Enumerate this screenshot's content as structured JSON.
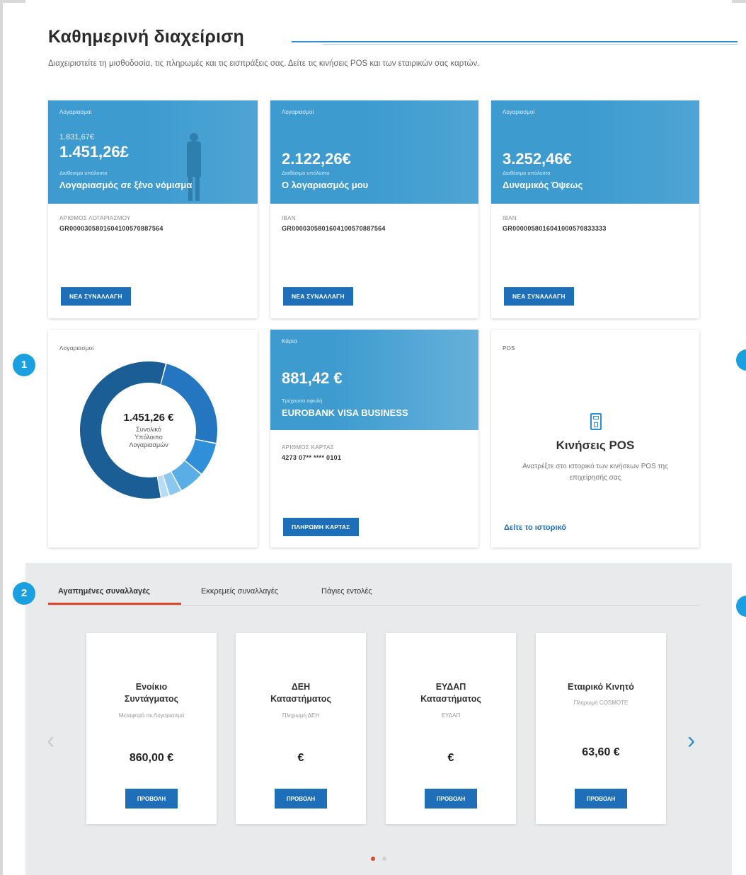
{
  "page": {
    "title": "Καθημερινή διαχείριση",
    "subtitle": "Διαχειριστείτε τη μισθοδοσία, τις πληρωμές και τις εισπράξεις σας. Δείτε τις κινήσεις POS και των εταιρικών σας καρτών."
  },
  "accounts": [
    {
      "tag": "Λογαριασμοί",
      "sub_amount": "1.831,67€",
      "amount": "1.451,26£",
      "amount_label": "Διαθέσιμο υπόλοιπο",
      "name": "Λογαριασμός σε ξένο νόμισμα",
      "field_label": "ΑΡΙΘΜΟΣ ΛΟΓΑΡΙΑΣΜΟΥ",
      "field_value": "GR0000305801604100570887564",
      "button": "ΝΕΑ ΣΥΝΑΛΛΑΓΗ"
    },
    {
      "tag": "Λογαριασμοί",
      "amount": "2.122,26€",
      "amount_label": "Διαθέσιμο υπόλοιπο",
      "name": "Ο λογαριασμός μου",
      "field_label": "IBAN",
      "field_value": "GR0000305801604100570887564",
      "button": "ΝΕΑ ΣΥΝΑΛΛΑΓΗ"
    },
    {
      "tag": "Λογαριασμοί",
      "amount": "3.252,46€",
      "amount_label": "Διαθέσιμο υπόλοιπο",
      "name": "Δυναμικός Όψεως",
      "field_label": "IBAN",
      "field_value": "GR0000058016041000570833333",
      "button": "ΝΕΑ ΣΥΝΑΛΛΑΓΗ"
    }
  ],
  "donut": {
    "tag": "Λογαριασμοί",
    "value": "1.451,26 €",
    "label_line1": "Συνολικό",
    "label_line2": "Υπόλοιπο",
    "label_line3": "Λογαριασμών",
    "segments": [
      {
        "share": 0.57,
        "color": "#1b5d95"
      },
      {
        "share": 0.24,
        "color": "#2476c0"
      },
      {
        "share": 0.08,
        "color": "#2f8fd8"
      },
      {
        "share": 0.06,
        "color": "#5aaee6"
      },
      {
        "share": 0.03,
        "color": "#8cc7ef"
      },
      {
        "share": 0.02,
        "color": "#b8dcf5"
      }
    ]
  },
  "card": {
    "tag": "Κάρτα",
    "amount": "881,42 €",
    "amount_label": "Τρέχουσα οφειλή",
    "name": "EUROBANK VISA BUSINESS",
    "field_label": "ΑΡΙΘΜΟΣ ΚΑΡΤΑΣ",
    "field_value": "4273 07** **** 0101",
    "button": "ΠΛΗΡΩΜΗ ΚΑΡΤΑΣ"
  },
  "pos": {
    "tag": "POS",
    "icon": "pos-terminal-icon",
    "title": "Κινήσεις POS",
    "description": "Ανατρέξτε στο ιστορικό των κινήσεων POS της επιχείρησής σας",
    "link": "Δείτε το ιστορικό"
  },
  "tabs": [
    {
      "label": "Αγαπημένες συναλλαγές",
      "active": true
    },
    {
      "label": "Εκκρεμείς συναλλαγές",
      "active": false
    },
    {
      "label": "Πάγιες εντολές",
      "active": false
    }
  ],
  "favorites": [
    {
      "name1": "Ενοίκιο",
      "name2": "Συντάγματος",
      "desc": "Μεταφορά σε Λογαριασμό",
      "value": "860,00 €",
      "button": "ΠΡΟΒΟΛΗ"
    },
    {
      "name1": "ΔΕΗ",
      "name2": "Καταστήματος",
      "desc": "Πληρωμή ΔΕΗ",
      "value": "€",
      "button": "ΠΡΟΒΟΛΗ"
    },
    {
      "name1": "ΕΥΔΑΠ",
      "name2": "Καταστήματος",
      "desc": "ΕΥΔΑΠ",
      "value": "€",
      "button": "ΠΡΟΒΟΛΗ"
    },
    {
      "name1": "Εταιρικό Κινητό",
      "name2": "",
      "desc": "Πληρωμή COSMOTE",
      "value": "63,60 €",
      "button": "ΠΡΟΒΟΛΗ"
    }
  ],
  "markers": {
    "one": "1",
    "two": "2"
  },
  "colors": {
    "brand_blue": "#1e6eb8",
    "card_blue": "#3d9bd0",
    "tab_active": "#e2452d",
    "marker": "#1a9fe0"
  }
}
